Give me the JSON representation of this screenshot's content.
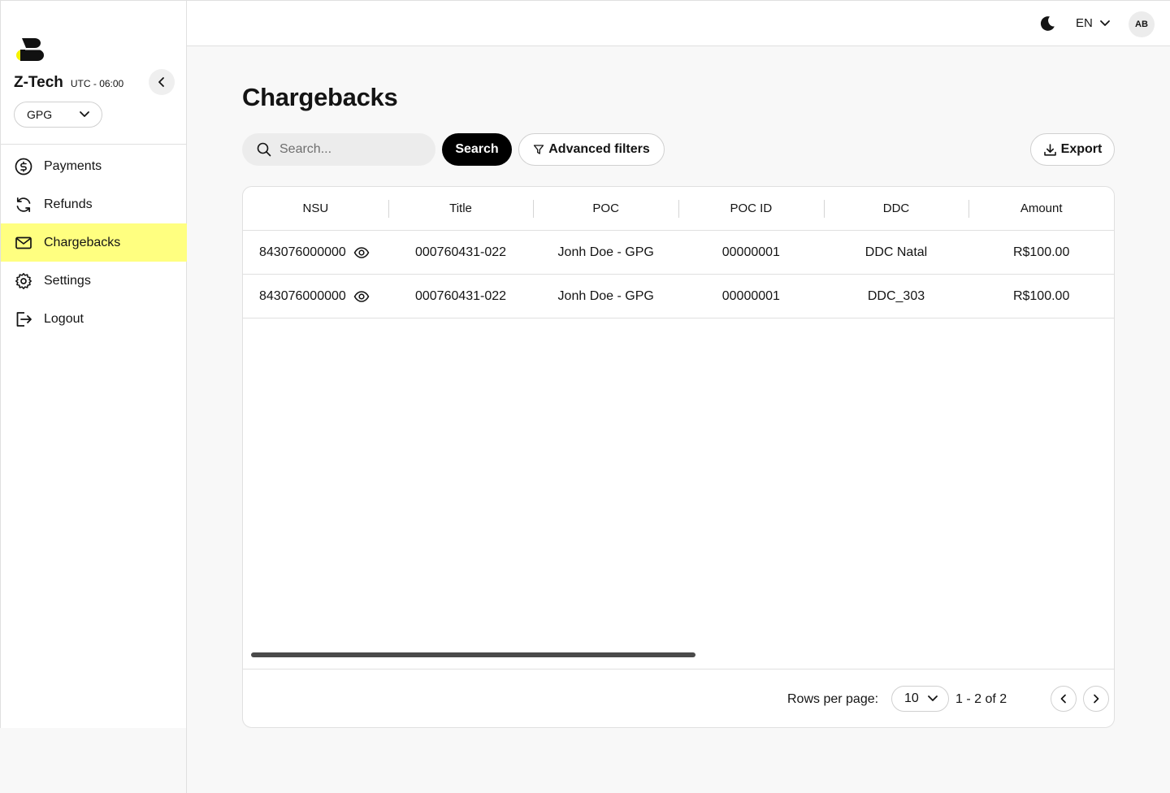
{
  "brand": {
    "name": "Z-Tech",
    "timezone": "UTC - 06:00",
    "vendor": "GPG",
    "accent": "#ffff80"
  },
  "sidebar": {
    "items": [
      {
        "label": "Payments",
        "icon": "dollar-circle-icon",
        "active": false
      },
      {
        "label": "Refunds",
        "icon": "refresh-icon",
        "active": false
      },
      {
        "label": "Chargebacks",
        "icon": "mail-icon",
        "active": true
      },
      {
        "label": "Settings",
        "icon": "gear-icon",
        "active": false
      },
      {
        "label": "Logout",
        "icon": "logout-icon",
        "active": false
      }
    ]
  },
  "header": {
    "language": "EN",
    "avatar_initials": "AB",
    "theme_icon": "moon-icon"
  },
  "main": {
    "title": "Chargebacks",
    "search": {
      "placeholder": "Search...",
      "value": "",
      "button": "Search"
    },
    "advanced_filters": "Advanced filters",
    "export": "Export"
  },
  "table": {
    "columns": [
      "NSU",
      "Title",
      "POC",
      "POC ID",
      "DDC",
      "Amount"
    ],
    "rows": [
      {
        "nsu": "843076000000",
        "title": "000760431-022",
        "poc": "Jonh Doe - GPG",
        "poc_id": "00000001",
        "ddc": "DDC Natal",
        "amount": "R$100.00"
      },
      {
        "nsu": "843076000000",
        "title": "000760431-022",
        "poc": "Jonh Doe - GPG",
        "poc_id": "00000001",
        "ddc": "DDC_303",
        "amount": "R$100.00"
      }
    ]
  },
  "pagination": {
    "rows_per_page_label": "Rows per page:",
    "rows_per_page": "10",
    "range": "1 - 2 of 2"
  }
}
